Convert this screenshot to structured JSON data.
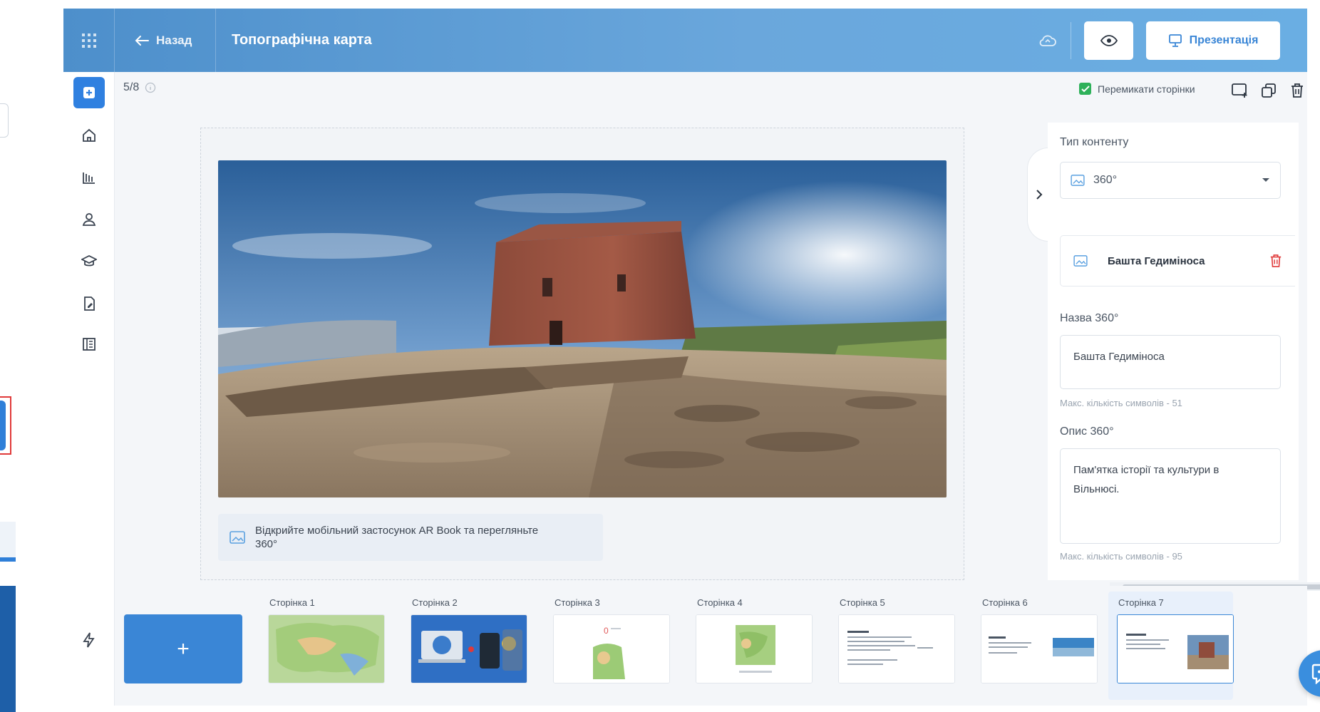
{
  "header": {
    "back_label": "Назад",
    "title": "Топографічна карта",
    "present_label": "Презентація"
  },
  "toolbar": {
    "page_counter": "5/8",
    "flip_pages_label": "Перемикати сторінки",
    "flip_pages_checked": true
  },
  "canvas": {
    "caption": "Відкрийте мобільний застосунок AR Book та перегляньте 360°"
  },
  "panel": {
    "content_type_label": "Тип контенту",
    "content_type_value": "360°",
    "item_name": "Башта Гедиміноса",
    "name_label": "Назва 360°",
    "name_value": "Башта Гедиміноса",
    "name_hint": "Макс. кількість символів - 51",
    "desc_label": "Опис 360°",
    "desc_value": "Пам'ятка історії та культури в Вільнюсі.",
    "desc_hint": "Макс. кількість символів - 95"
  },
  "pages": [
    {
      "label": "Сторінка 1",
      "kind": "map"
    },
    {
      "label": "Сторінка 2",
      "kind": "devices"
    },
    {
      "label": "Сторінка 3",
      "kind": "map-small"
    },
    {
      "label": "Сторінка 4",
      "kind": "map-center"
    },
    {
      "label": "Сторінка 5",
      "kind": "text"
    },
    {
      "label": "Сторінка 6",
      "kind": "text-image"
    },
    {
      "label": "Сторінка 7",
      "kind": "text-photo",
      "active": true
    }
  ],
  "add_page_label": "+",
  "colors": {
    "accent": "#3a86d6",
    "header_start": "#4d8fcb",
    "header_end": "#6aaee3",
    "checkbox": "#2eb15a",
    "delete": "#e03a3a"
  },
  "icons": {
    "menu": "grid-icon",
    "back": "arrow-left-icon",
    "sync": "cloud-sync-icon",
    "preview": "eye-icon",
    "present": "presentation-icon",
    "rail": [
      "add-square-icon",
      "home-icon",
      "library-icon",
      "users-icon",
      "graduation-cap-icon",
      "document-edit-icon",
      "book-icon",
      "bolt-icon"
    ],
    "tools": [
      "add-page-icon",
      "duplicate-icon",
      "trash-icon"
    ],
    "chat": "chat-bubble-icon"
  }
}
